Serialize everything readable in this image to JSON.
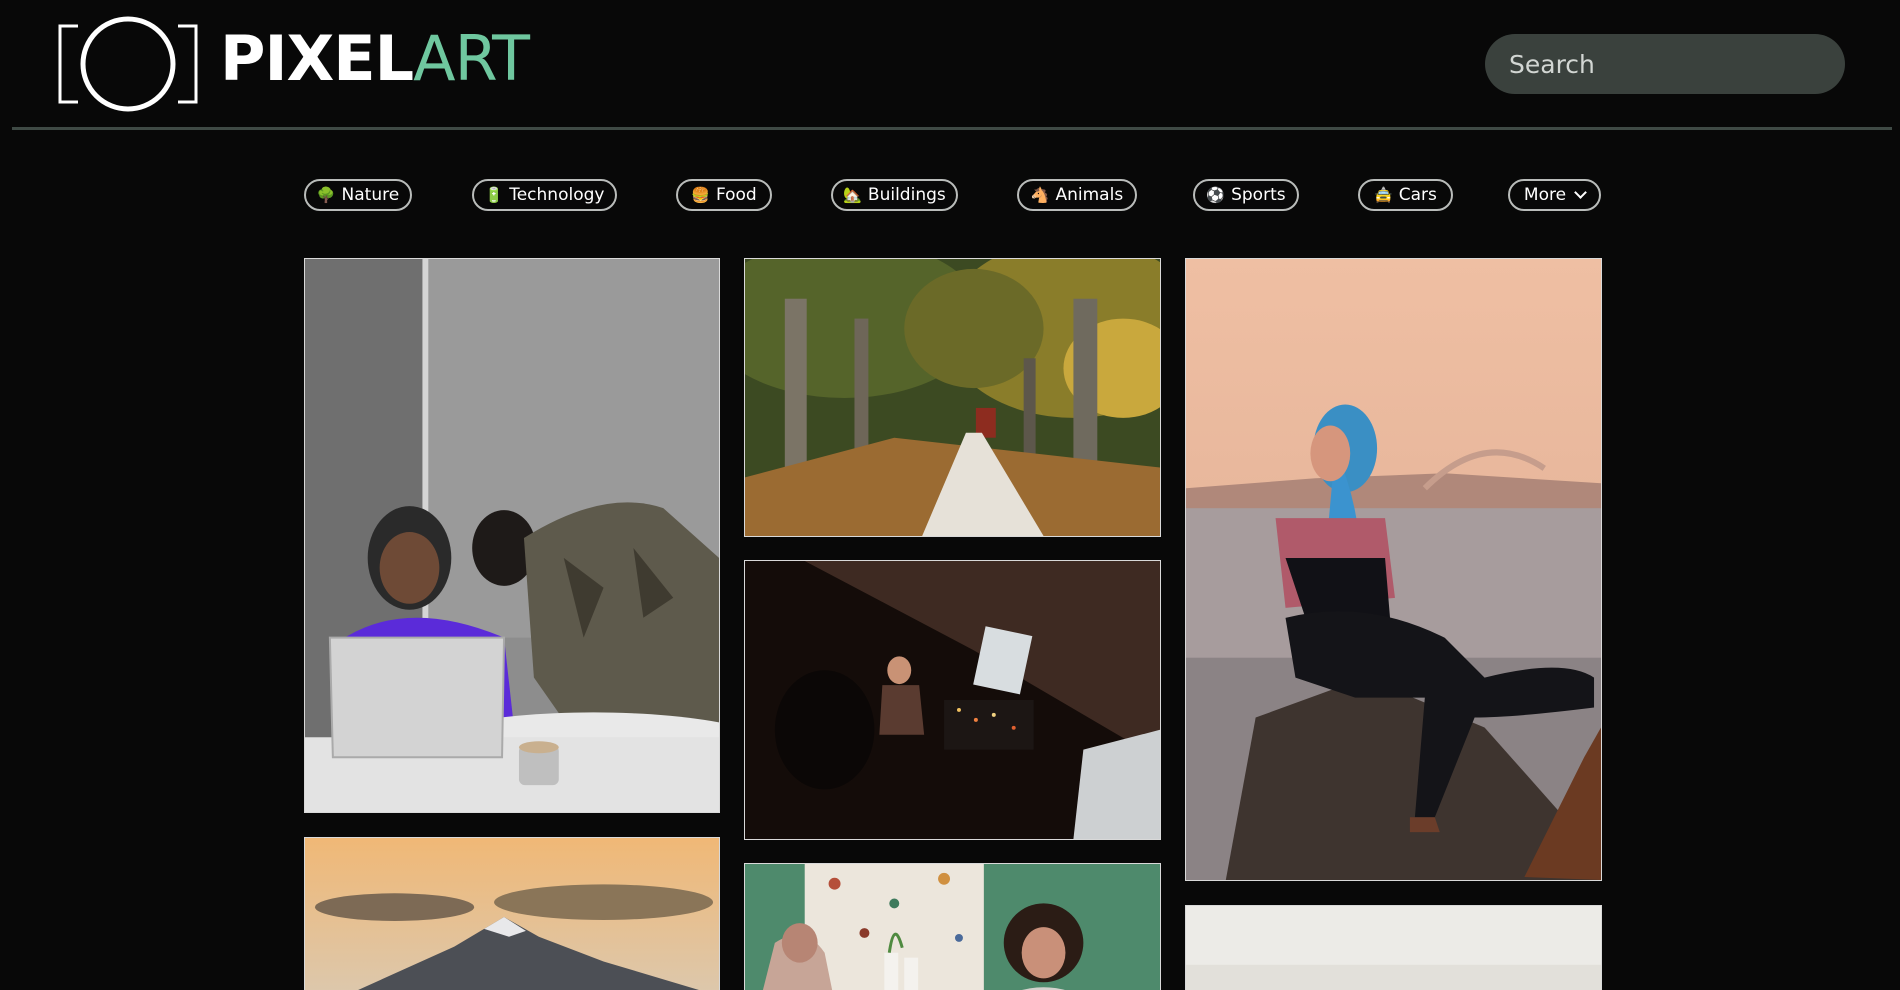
{
  "header": {
    "brand_bold": "PIXEL",
    "brand_light": "ART",
    "search_placeholder": "Search"
  },
  "categories": [
    {
      "icon": "🌳",
      "label": "Nature"
    },
    {
      "icon": "🔋",
      "label": "Technology"
    },
    {
      "icon": "🍔",
      "label": "Food"
    },
    {
      "icon": "🏡",
      "label": "Buildings"
    },
    {
      "icon": "🐴",
      "label": "Animals"
    },
    {
      "icon": "⚽",
      "label": "Sports"
    },
    {
      "icon": "🚖",
      "label": "Cars"
    }
  ],
  "more": {
    "label": "More"
  },
  "colors": {
    "background": "#080808",
    "accent": "#6fc79f",
    "search_bg": "#3a413d",
    "divider": "#3f4a45"
  }
}
